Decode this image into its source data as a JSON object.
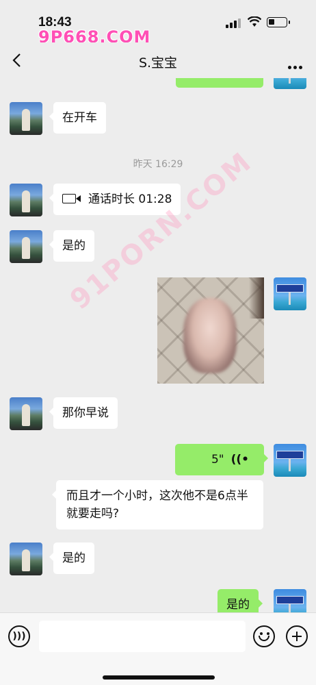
{
  "status_bar": {
    "time": "18:43",
    "watermark": "9P668.COM"
  },
  "header": {
    "title": "S.宝宝"
  },
  "chat": {
    "watermark": "91PORN.COM",
    "messages": [
      {
        "side": "left",
        "type": "text",
        "text": "在开车"
      },
      {
        "type": "timestamp",
        "text": "昨天 16:29"
      },
      {
        "side": "left",
        "type": "call",
        "text": "通话时长 01:28",
        "icon": "video-call-icon"
      },
      {
        "side": "left",
        "type": "text",
        "text": "是的"
      },
      {
        "side": "right",
        "type": "image"
      },
      {
        "side": "left",
        "type": "text",
        "text": "那你早说"
      },
      {
        "side": "right",
        "type": "voice",
        "duration": "5\"",
        "icon": "voice-wave-icon"
      },
      {
        "side": "left",
        "type": "text",
        "text": "而且才一个小时，这次他不是6点半就要走吗?"
      },
      {
        "side": "left",
        "type": "text",
        "text": "是的"
      },
      {
        "side": "right",
        "type": "text",
        "text": "是的"
      }
    ]
  },
  "input_bar": {
    "placeholder": ""
  },
  "colors": {
    "background": "#ededed",
    "sent_bubble": "#95ec69",
    "received_bubble": "#ffffff"
  }
}
